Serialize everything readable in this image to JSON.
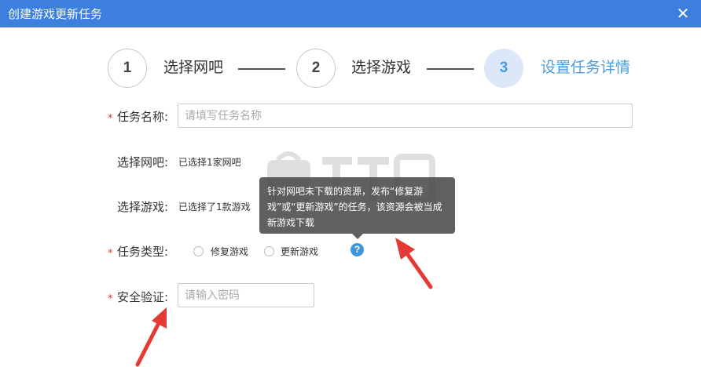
{
  "dialog": {
    "title": "创建游戏更新任务",
    "close_glyph": "✕"
  },
  "steps": [
    {
      "number": "1",
      "label": "选择网吧"
    },
    {
      "number": "2",
      "label": "选择游戏"
    },
    {
      "number": "3",
      "label": "设置任务详情"
    }
  ],
  "form": {
    "required_mark": "*",
    "task_name": {
      "label": "任务名称:",
      "placeholder": "请填写任务名称",
      "value": ""
    },
    "select_netbar": {
      "label": "选择网吧:",
      "value": "已选择1家网吧"
    },
    "select_game": {
      "label": "选择游戏:",
      "value": "已选择了1款游戏"
    },
    "task_type": {
      "label": "任务类型:",
      "options": [
        "修复游戏",
        "更新游戏"
      ],
      "help_glyph": "?"
    },
    "security": {
      "label": "安全验证:",
      "placeholder": "请输入密码",
      "value": ""
    }
  },
  "tooltip": {
    "text": "针对网吧未下载的资源，发布“修复游戏”或“更新游戏”的任务，该资源会被当成新游戏下载"
  },
  "colors": {
    "titlebar": "#3c7fde",
    "active_step": "#4a9ce0",
    "required": "#d23a3a",
    "annotation_arrow": "#e53935"
  },
  "icons": {
    "close": "close-icon",
    "help": "help-icon"
  }
}
